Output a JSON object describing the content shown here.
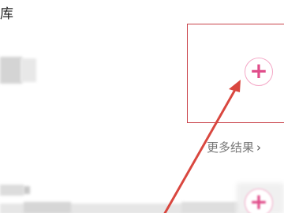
{
  "header": {
    "title_fragment": "库"
  },
  "results": {
    "add_symbol": "+",
    "more_label": "更多结果",
    "more_chevron": "›"
  },
  "colors": {
    "annotation_red": "#c9434a",
    "add_accent": "#e04d8a",
    "add_ring": "#f4a7c6",
    "more_text": "#777777"
  },
  "icons": {
    "add": "plus-circle-icon",
    "chevron": "chevron-right-icon"
  }
}
